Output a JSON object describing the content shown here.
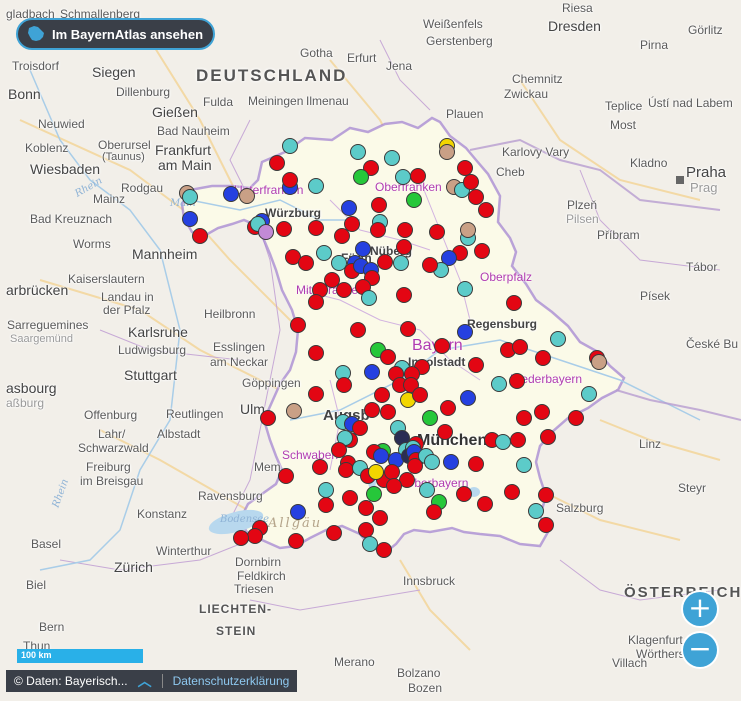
{
  "button": {
    "label": "Im BayernAtlas ansehen"
  },
  "countries": [
    {
      "id": "de",
      "label": "DEUTSCHLAND"
    },
    {
      "id": "at",
      "label": "ÖSTERREICH"
    },
    {
      "id": "li1",
      "label": "LIECHTEN-"
    },
    {
      "id": "li2",
      "label": "STEIN"
    }
  ],
  "regions": [
    {
      "id": "ofr",
      "label": "Oberfranken"
    },
    {
      "id": "ufr",
      "label": "Unterfranken"
    },
    {
      "id": "mfr",
      "label": "Mittelfranken"
    },
    {
      "id": "opf",
      "label": "Oberpfalz"
    },
    {
      "id": "ndb",
      "label": "Niederbayern"
    },
    {
      "id": "schw",
      "label": "Schwaben"
    },
    {
      "id": "obb",
      "label": "Oberbayern"
    },
    {
      "id": "bay",
      "label": "Bayern"
    }
  ],
  "rivers": [
    {
      "id": "rhein1",
      "label": "Rhein"
    },
    {
      "id": "rhein2",
      "label": "Rhein"
    },
    {
      "id": "main",
      "label": "Main"
    },
    {
      "id": "allgaeu",
      "label": "Allgäu"
    },
    {
      "id": "bodensee",
      "label": "Bodensee"
    }
  ],
  "cities": [
    {
      "id": "gladbach",
      "label": "gladbach"
    },
    {
      "id": "schmallenberg",
      "label": "Schmallenberg"
    },
    {
      "id": "troisdorf",
      "label": "Troisdorf"
    },
    {
      "id": "siegen",
      "label": "Siegen"
    },
    {
      "id": "dillenburg",
      "label": "Dillenburg"
    },
    {
      "id": "bonn",
      "label": "Bonn"
    },
    {
      "id": "neuwied",
      "label": "Neuwied"
    },
    {
      "id": "giessen",
      "label": "Gießen"
    },
    {
      "id": "badnauheim",
      "label": "Bad Nauheim"
    },
    {
      "id": "koblenz",
      "label": "Koblenz"
    },
    {
      "id": "oberursel1",
      "label": "Oberursel"
    },
    {
      "id": "oberursel2",
      "label": "(Taunus)"
    },
    {
      "id": "frankfurt1",
      "label": "Frankfurt"
    },
    {
      "id": "frankfurt2",
      "label": "am Main"
    },
    {
      "id": "wiesbaden",
      "label": "Wiesbaden"
    },
    {
      "id": "rodgau",
      "label": "Rodgau"
    },
    {
      "id": "mainz",
      "label": "Mainz"
    },
    {
      "id": "badkreuznach",
      "label": "Bad Kreuznach"
    },
    {
      "id": "worms",
      "label": "Worms"
    },
    {
      "id": "mannheim",
      "label": "Mannheim"
    },
    {
      "id": "kaiserslautern",
      "label": "Kaiserslautern"
    },
    {
      "id": "saarbruecken",
      "label": "arbrücken"
    },
    {
      "id": "landau1",
      "label": "Landau in"
    },
    {
      "id": "landau2",
      "label": "der Pfalz"
    },
    {
      "id": "sarreguemines",
      "label": "Sarreguemines"
    },
    {
      "id": "saargemuend",
      "label": "Saargemünd"
    },
    {
      "id": "karlsruhe",
      "label": "Karlsruhe"
    },
    {
      "id": "ludwigsburg",
      "label": "Ludwigsburg"
    },
    {
      "id": "heilbronn",
      "label": "Heilbronn"
    },
    {
      "id": "stuttgart",
      "label": "Stuttgart"
    },
    {
      "id": "esslingen1",
      "label": "Esslingen"
    },
    {
      "id": "esslingen2",
      "label": "am Neckar"
    },
    {
      "id": "goeppingen",
      "label": "Göppingen"
    },
    {
      "id": "strasbourg1",
      "label": "asbourg"
    },
    {
      "id": "strasbourg2",
      "label": "aßburg"
    },
    {
      "id": "offenburg",
      "label": "Offenburg"
    },
    {
      "id": "reutlingen",
      "label": "Reutlingen"
    },
    {
      "id": "ulm",
      "label": "Ulm"
    },
    {
      "id": "lahr1",
      "label": "Lahr/"
    },
    {
      "id": "lahr2",
      "label": "Schwarzwald"
    },
    {
      "id": "albstadt",
      "label": "Albstadt"
    },
    {
      "id": "freiburg1",
      "label": "Freiburg"
    },
    {
      "id": "freiburg2",
      "label": "im Breisgau"
    },
    {
      "id": "memmingen",
      "label": "Mem"
    },
    {
      "id": "ravensburg",
      "label": "Ravensburg"
    },
    {
      "id": "konstanz",
      "label": "Konstanz"
    },
    {
      "id": "basel",
      "label": "Basel"
    },
    {
      "id": "winterthur",
      "label": "Winterthur"
    },
    {
      "id": "zuerich",
      "label": "Zürich"
    },
    {
      "id": "dornbirn",
      "label": "Dornbirn"
    },
    {
      "id": "feldkirch",
      "label": "Feldkirch"
    },
    {
      "id": "triesen",
      "label": "Triesen"
    },
    {
      "id": "biel",
      "label": "Biel"
    },
    {
      "id": "bern",
      "label": "Bern"
    },
    {
      "id": "thun",
      "label": "Thun"
    },
    {
      "id": "gotha",
      "label": "Gotha"
    },
    {
      "id": "erfurt",
      "label": "Erfurt"
    },
    {
      "id": "jena",
      "label": "Jena"
    },
    {
      "id": "weissenfels",
      "label": "Weißenfels"
    },
    {
      "id": "gerstenberg",
      "label": "Gerstenberg"
    },
    {
      "id": "fulda",
      "label": "Fulda"
    },
    {
      "id": "meiningen",
      "label": "Meiningen"
    },
    {
      "id": "ilmenau",
      "label": "Ilmenau"
    },
    {
      "id": "plauen",
      "label": "Plauen"
    },
    {
      "id": "chemnitz",
      "label": "Chemnitz"
    },
    {
      "id": "zwickau",
      "label": "Zwickau"
    },
    {
      "id": "dresden",
      "label": "Dresden"
    },
    {
      "id": "riesa",
      "label": "Riesa"
    },
    {
      "id": "goerlitz",
      "label": "Görlitz"
    },
    {
      "id": "pirna",
      "label": "Pirna"
    },
    {
      "id": "teplice",
      "label": "Teplice"
    },
    {
      "id": "ustilabem",
      "label": "Ústí nad Labem"
    },
    {
      "id": "most",
      "label": "Most"
    },
    {
      "id": "karlovyvary",
      "label": "Karlovy Vary"
    },
    {
      "id": "cheb",
      "label": "Cheb"
    },
    {
      "id": "kladno",
      "label": "Kladno"
    },
    {
      "id": "praha",
      "label": "Praha"
    },
    {
      "id": "prag",
      "label": "Prag"
    },
    {
      "id": "plzen",
      "label": "Plzeň"
    },
    {
      "id": "pilsen",
      "label": "Pilsen"
    },
    {
      "id": "pribram",
      "label": "Příbram"
    },
    {
      "id": "tabor",
      "label": "Tábor"
    },
    {
      "id": "pisek",
      "label": "Písek"
    },
    {
      "id": "ceskebud",
      "label": "České Bu"
    },
    {
      "id": "wuerzburg",
      "label": "Würzburg"
    },
    {
      "id": "fuerth",
      "label": "Fürth"
    },
    {
      "id": "nuernberg",
      "label": "Nüberg"
    },
    {
      "id": "regensburg",
      "label": "Regensburg"
    },
    {
      "id": "ingolstadt",
      "label": "Ingolstadt"
    },
    {
      "id": "augsburg",
      "label": "Augsb"
    },
    {
      "id": "muenchen",
      "label": "München"
    },
    {
      "id": "linz",
      "label": "Linz"
    },
    {
      "id": "salzburg",
      "label": "Salzburg"
    },
    {
      "id": "steyr",
      "label": "Steyr"
    },
    {
      "id": "innsbruck",
      "label": "Innsbruck"
    },
    {
      "id": "klagenfurt",
      "label": "Klagenfurt"
    },
    {
      "id": "woerthersee",
      "label": "Wörthersee"
    },
    {
      "id": "villach",
      "label": "Villach"
    },
    {
      "id": "merano",
      "label": "Merano"
    },
    {
      "id": "bolzano",
      "label": "Bolzano"
    },
    {
      "id": "bozen",
      "label": "Bozen"
    }
  ],
  "scale": {
    "label": "100 km"
  },
  "attribution": {
    "text": "© Daten: Bayerisch...",
    "link": "Datenschutzerklärung"
  },
  "zoom": {
    "in": "+",
    "out": "−"
  },
  "legend_colors": {
    "red": "#e30613",
    "teal": "#5ccbc9",
    "blue": "#2540e0",
    "green": "#26c73a",
    "brown": "#c9a086",
    "yellow": "#f2d600",
    "navy": "#2b2d54"
  }
}
